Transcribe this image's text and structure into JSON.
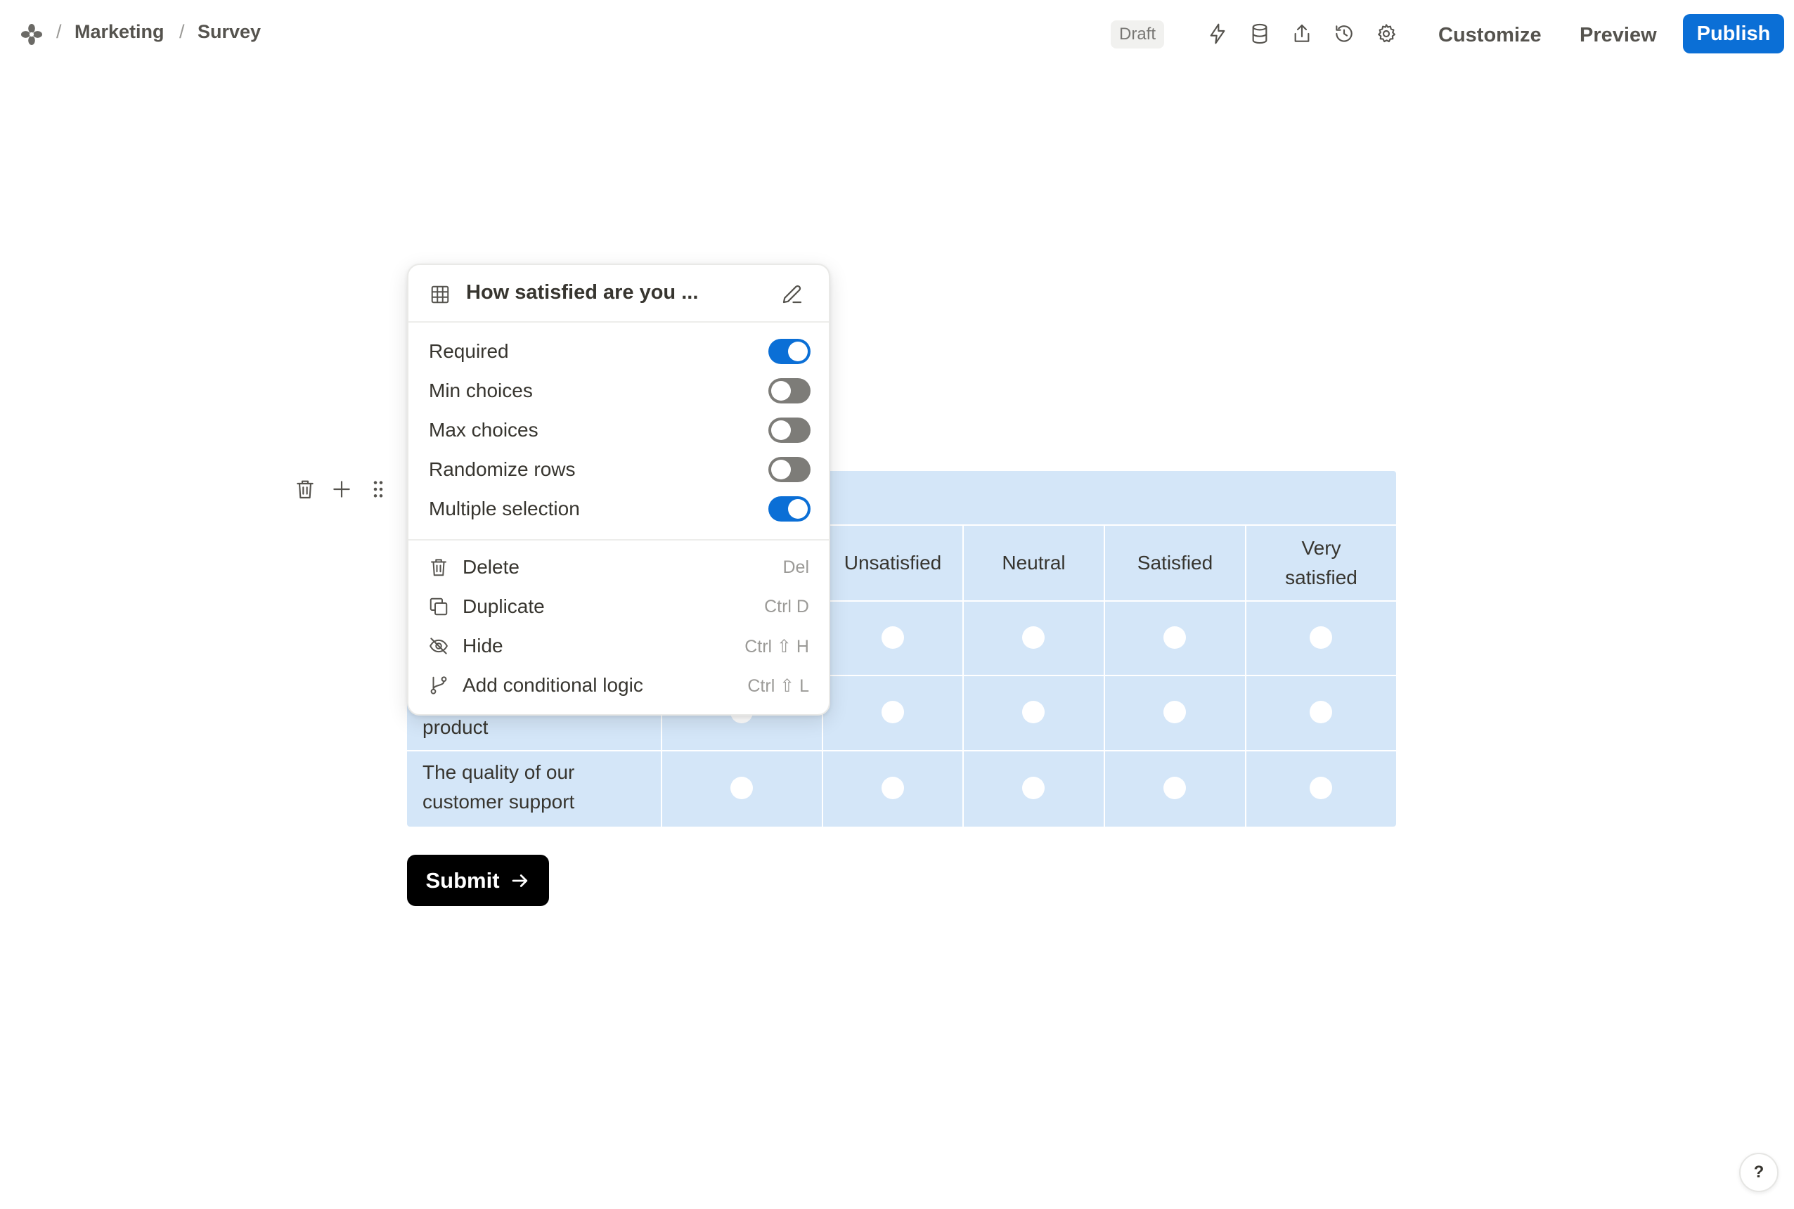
{
  "breadcrumb": {
    "items": [
      "Marketing",
      "Survey"
    ],
    "separator": "/"
  },
  "header": {
    "status_badge": "Draft",
    "icons": [
      "lightning-icon",
      "database-icon",
      "share-icon",
      "history-icon",
      "gear-icon"
    ],
    "customize_label": "Customize",
    "preview_label": "Preview",
    "publish_label": "Publish"
  },
  "block_tools": [
    "trash-icon",
    "plus-icon",
    "drag-handle-icon"
  ],
  "matrix": {
    "columns": [
      "Unsatisfied",
      "Neutral",
      "Satisfied",
      "Very satisfied"
    ],
    "columns_display": [
      "Unsatisfied",
      "Neutral",
      "Satisfied",
      "Very\nsatisfied"
    ],
    "rows": [
      "product",
      "The quality of our customer support"
    ],
    "rows_display": [
      "product",
      "The quality of our\ncustomer support"
    ]
  },
  "submit": {
    "label": "Submit"
  },
  "question_menu": {
    "title": "How satisfied are you ...",
    "toggles": [
      {
        "label": "Required",
        "on": true
      },
      {
        "label": "Min choices",
        "on": false
      },
      {
        "label": "Max choices",
        "on": false
      },
      {
        "label": "Randomize rows",
        "on": false
      },
      {
        "label": "Multiple selection",
        "on": true
      }
    ],
    "actions": [
      {
        "label": "Delete",
        "shortcut": "Del",
        "icon": "trash-icon"
      },
      {
        "label": "Duplicate",
        "shortcut": "Ctrl D",
        "icon": "duplicate-icon"
      },
      {
        "label": "Hide",
        "shortcut": "Ctrl ⇧ H",
        "icon": "eye-off-icon"
      },
      {
        "label": "Add conditional logic",
        "shortcut": "Ctrl ⇧ L",
        "icon": "branch-icon"
      }
    ]
  },
  "help": {
    "label": "?"
  },
  "colors": {
    "accent": "#0b6fd6",
    "matrix_bg": "#d4e6f8",
    "toggle_off": "#7d7c78",
    "submit_bg": "#000000"
  }
}
